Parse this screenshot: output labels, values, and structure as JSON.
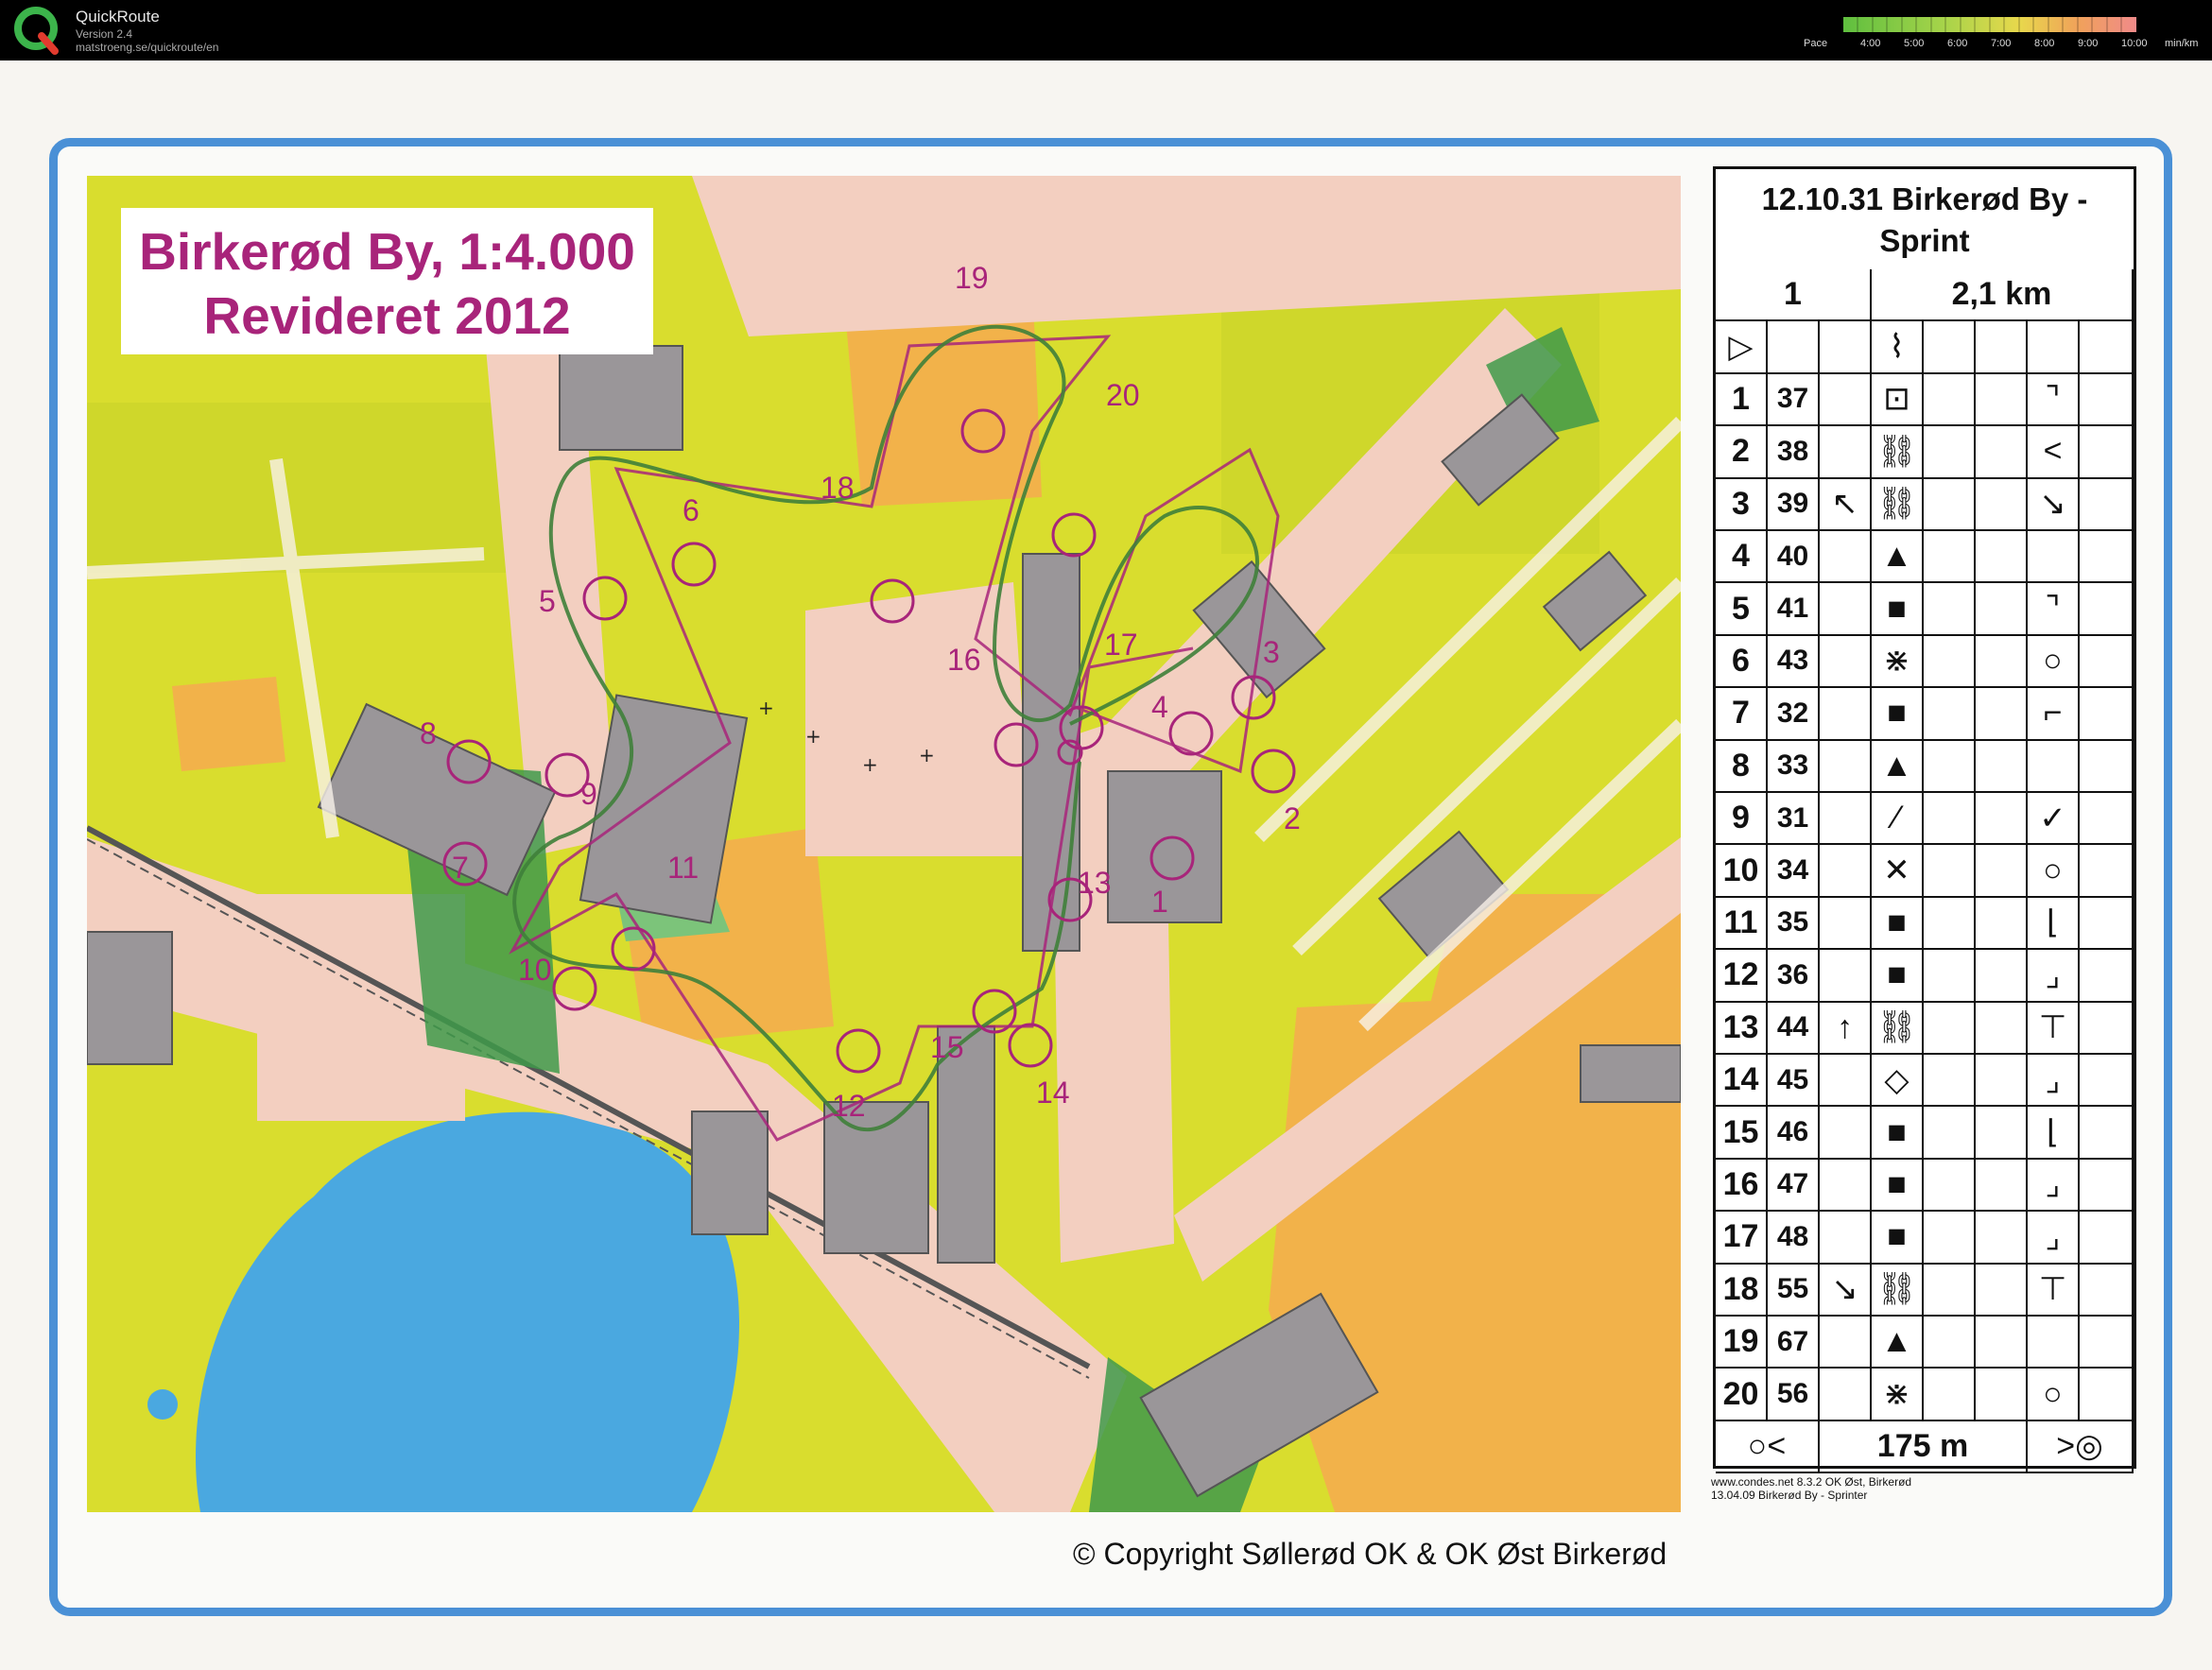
{
  "app": {
    "name": "QuickRoute",
    "version": "Version 2.4",
    "url": "matstroeng.se/quickroute/en"
  },
  "pace_scale": {
    "label": "Pace",
    "ticks": [
      "4:00",
      "5:00",
      "6:00",
      "7:00",
      "8:00",
      "9:00",
      "10:00"
    ],
    "unit": "min/km"
  },
  "map": {
    "title_line1": "Birkerød By, 1:4.000",
    "title_line2": "Revideret 2012",
    "copyright": "© Copyright Søllerød OK & OK Øst Birkerød",
    "course_color": "#a8247a",
    "route_color": "#3f7f3a",
    "control_labels": [
      "1",
      "2",
      "3",
      "4",
      "5",
      "6",
      "7",
      "8",
      "9",
      "10",
      "11",
      "12",
      "13",
      "14",
      "15",
      "16",
      "17",
      "18",
      "19",
      "20"
    ]
  },
  "control_descriptions": {
    "title": "12.10.31 Birkerød By - Sprint",
    "course": "1",
    "length": "2,1 km",
    "rows": [
      {
        "no": "1",
        "code": "37"
      },
      {
        "no": "2",
        "code": "38"
      },
      {
        "no": "3",
        "code": "39"
      },
      {
        "no": "4",
        "code": "40"
      },
      {
        "no": "5",
        "code": "41"
      },
      {
        "no": "6",
        "code": "43"
      },
      {
        "no": "7",
        "code": "32"
      },
      {
        "no": "8",
        "code": "33"
      },
      {
        "no": "9",
        "code": "31"
      },
      {
        "no": "10",
        "code": "34"
      },
      {
        "no": "11",
        "code": "35"
      },
      {
        "no": "12",
        "code": "36"
      },
      {
        "no": "13",
        "code": "44"
      },
      {
        "no": "14",
        "code": "45"
      },
      {
        "no": "15",
        "code": "46"
      },
      {
        "no": "16",
        "code": "47"
      },
      {
        "no": "17",
        "code": "48"
      },
      {
        "no": "18",
        "code": "55"
      },
      {
        "no": "19",
        "code": "67"
      },
      {
        "no": "20",
        "code": "56"
      }
    ],
    "finish_distance": "175 m",
    "footer_line1": "www.condes.net 8.3.2 OK Øst, Birkerød",
    "footer_line2": "13.04.09 Birkerød By - Sprinter"
  }
}
